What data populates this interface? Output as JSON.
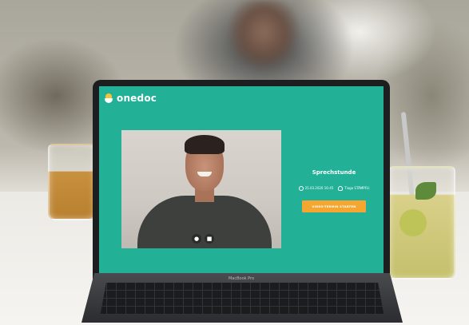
{
  "app": {
    "brand": "onedoc",
    "colors": {
      "accent": "#22b196",
      "cta": "#f4a630",
      "logo_yellow": "#f4c43a"
    }
  },
  "video": {
    "controls": [
      {
        "icon": "microphone-icon"
      },
      {
        "icon": "camera-icon"
      }
    ]
  },
  "appointment": {
    "title": "Sprechstunde",
    "datetime": "25.03.2020 16:45",
    "doctor": "Tiago STÄMPFLI",
    "cta_label": "VIDEO-TERMIN STARTEN"
  },
  "device": {
    "label": "MacBook Pro"
  }
}
